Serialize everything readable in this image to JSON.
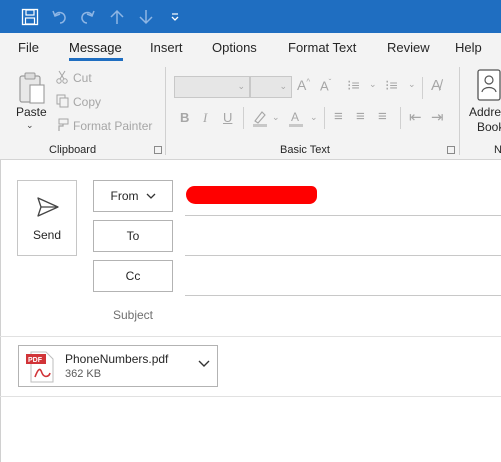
{
  "titlebar": {
    "icons": [
      "save-icon",
      "undo-icon",
      "redo-icon",
      "up-arrow-icon",
      "down-arrow-icon",
      "customize-toolbar-icon"
    ],
    "color": "#1f6ec1"
  },
  "tabs": [
    {
      "label": "File"
    },
    {
      "label": "Message"
    },
    {
      "label": "Insert"
    },
    {
      "label": "Options"
    },
    {
      "label": "Format Text"
    },
    {
      "label": "Review"
    },
    {
      "label": "Help"
    }
  ],
  "active_tab": "Message",
  "ribbon": {
    "clipboard": {
      "paste_label": "Paste",
      "cut_label": "Cut",
      "copy_label": "Copy",
      "format_painter_label": "Format Painter",
      "group_label": "Clipboard"
    },
    "basic_text": {
      "bold": "B",
      "italic": "I",
      "underline": "U",
      "group_label": "Basic Text"
    },
    "names": {
      "address_book_line1": "Addre",
      "address_book_line2": "Book",
      "group_label_partial": "N"
    }
  },
  "compose": {
    "send_label": "Send",
    "from_label": "From",
    "to_label": "To",
    "cc_label": "Cc",
    "subject_label": "Subject"
  },
  "attachment": {
    "icon_text": "PDF",
    "name": "PhoneNumbers.pdf",
    "size": "362 KB"
  }
}
